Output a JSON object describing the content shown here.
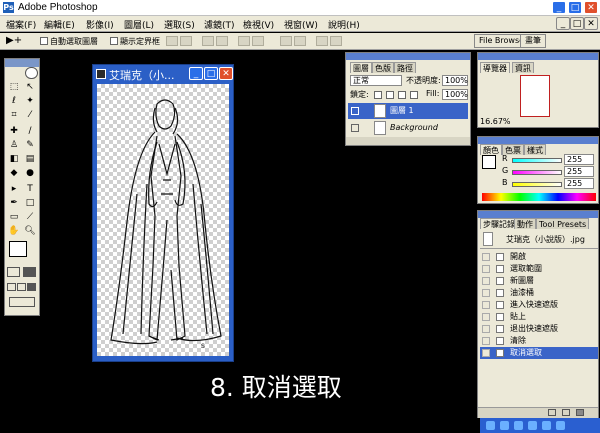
{
  "app": {
    "title": "Adobe Photoshop",
    "icon": "Ps"
  },
  "menu": [
    "檔案(F)",
    "編輯(E)",
    "影像(I)",
    "圖層(L)",
    "選取(S)",
    "濾鏡(T)",
    "檢視(V)",
    "視窗(W)",
    "說明(H)"
  ],
  "options": {
    "auto_select": "自動選取圖層",
    "show_bounds": "顯示定界框",
    "file_browser": "File Browser",
    "brushes": "畫筆"
  },
  "document": {
    "title": "艾瑞克（小..."
  },
  "layers": {
    "tabs": [
      "圖層",
      "色版",
      "路徑"
    ],
    "blend_mode": "正常",
    "opacity_label": "不透明度:",
    "opacity_value": "100%",
    "lock_label": "鎖定:",
    "fill_label": "Fill:",
    "fill_value": "100%",
    "items": [
      "圖層 1",
      "Background"
    ]
  },
  "navigator": {
    "tabs": [
      "導覽器",
      "資訊"
    ],
    "zoom": "16.67%"
  },
  "color": {
    "tabs": [
      "顏色",
      "色票",
      "樣式"
    ],
    "channels": [
      {
        "label": "R",
        "value": "255"
      },
      {
        "label": "G",
        "value": "255"
      },
      {
        "label": "B",
        "value": "255"
      }
    ]
  },
  "history": {
    "tabs": [
      "步驟記錄",
      "動作",
      "Tool Presets"
    ],
    "snapshot": "艾瑞克（小說版）.jpg",
    "steps": [
      "開啟",
      "選取範圍",
      "新圖層",
      "油漆桶",
      "進入快速遮版",
      "貼上",
      "退出快速遮版",
      "清除",
      "取消選取"
    ]
  },
  "caption": "8. 取消選取",
  "colors": {
    "accent": "#2b5fc6",
    "selected": "#3a64c8"
  }
}
